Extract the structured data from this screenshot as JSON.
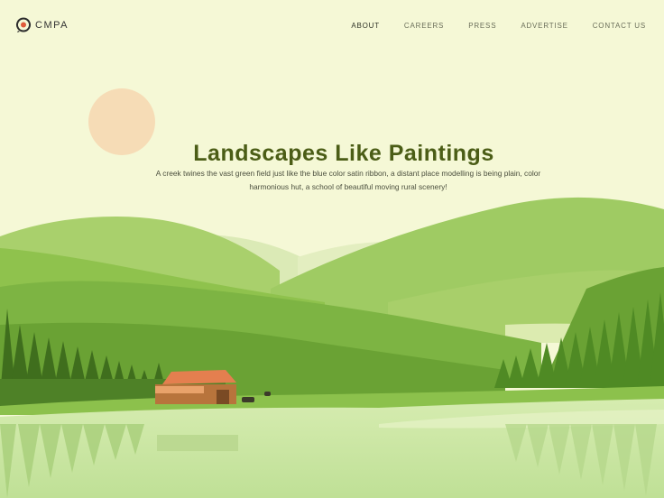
{
  "brand": {
    "name": "CMPA"
  },
  "nav": {
    "items": [
      {
        "label": "ABOUT",
        "active": true
      },
      {
        "label": "CAREERS",
        "active": false
      },
      {
        "label": "PRESS",
        "active": false
      },
      {
        "label": "ADVERTISE",
        "active": false
      },
      {
        "label": "CONTACT US",
        "active": false
      }
    ]
  },
  "hero": {
    "title": "Landscapes Like Paintings",
    "subtitle": "A creek twines the vast green field just like the blue color satin ribbon, a distant place modelling is being plain, color harmonious hut, a school of beautiful moving rural scenery!"
  },
  "colors": {
    "background": "#f5f8d6",
    "title": "#4b5d16",
    "sun": "#f6dcb6",
    "logo_accent": "#e05a3a"
  }
}
